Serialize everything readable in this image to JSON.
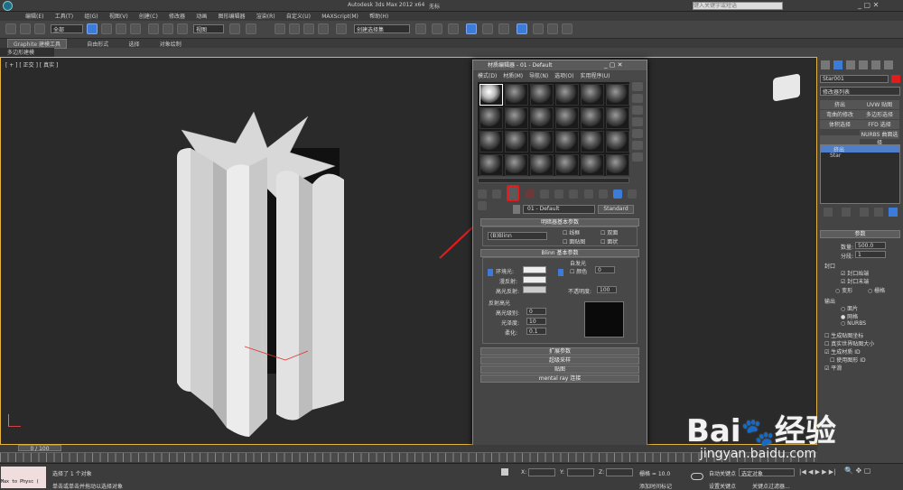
{
  "title_bar": {
    "app": "Autodesk 3ds Max  2012 x64",
    "doc": "无标",
    "search_placeholder": "键入关键字或短语"
  },
  "menu": [
    "编辑(E)",
    "工具(T)",
    "组(G)",
    "视图(V)",
    "创建(C)",
    "修改器",
    "动画",
    "图形编辑器",
    "渲染(R)",
    "自定义(U)",
    "MAXScript(M)",
    "帮助(H)"
  ],
  "toolbar": {
    "filter_value": "全部",
    "view_value": "视图",
    "selection_set": "创建选择集"
  },
  "ribbon": {
    "tabs": [
      "Graphite 建模工具",
      "自由形式",
      "选择",
      "对象绘制"
    ]
  },
  "poly_label": "多边形建模",
  "viewport": {
    "label": "[ + ] [ 正交 ] [ 真实 ]"
  },
  "material_editor": {
    "title": "材质编辑器 - 01 - Default",
    "menu": [
      "模式(D)",
      "材质(M)",
      "导航(N)",
      "选项(O)",
      "实用程序(U)"
    ],
    "material_name": "01 - Default",
    "material_type": "Standard",
    "shader_rollout": "明暗器基本参数",
    "shader_value": "(B)Blinn",
    "shader_options": [
      "线框",
      "双面",
      "面贴图",
      "面状"
    ],
    "blinn_rollout": "Blinn 基本参数",
    "ambient": "环境光:",
    "diffuse": "漫反射:",
    "specular": "高光反射:",
    "self_illum": "自发光",
    "color_label": "颜色",
    "self_illum_value": "0",
    "opacity_label": "不透明度:",
    "opacity_value": "100",
    "spec_highlights": "反射高光",
    "spec_level_label": "高光级别:",
    "spec_level_value": "0",
    "gloss_label": "光泽度:",
    "gloss_value": "10",
    "soften_label": "柔化:",
    "soften_value": "0.1",
    "rollouts": [
      "扩展参数",
      "超级采样",
      "贴图",
      "mental ray 连接"
    ]
  },
  "right_panel": {
    "object_name": "Star001",
    "modifier_list": "修改器列表",
    "buttons": [
      "挤出",
      "UVW 贴图",
      "弯曲的修改",
      "多边形选择",
      "体积选择",
      "FFD 选择",
      "",
      "NURBS 曲面选择"
    ],
    "stack": [
      "挤出",
      "Star"
    ],
    "params_title": "参数",
    "amount_label": "数量:",
    "amount_value": "500.0",
    "segments_label": "分段:",
    "segments_value": "1",
    "capping": "封口",
    "cap_start": "封口始端",
    "cap_end": "封口末端",
    "morph": "变形",
    "grid": "栅格",
    "output": "输出",
    "patch": "面片",
    "mesh": "网格",
    "nurbs": "NURBS",
    "gen_map": "生成贴图坐标",
    "real_world": "真实世界贴图大小",
    "gen_mat_ids": "生成材质 ID",
    "use_shape_ids": "使用图形 ID",
    "smooth": "平滑"
  },
  "timeline": {
    "frame": "0 / 100",
    "ticks": [
      "0",
      "5",
      "10",
      "15",
      "20",
      "25",
      "30",
      "35",
      "40",
      "45",
      "50",
      "55",
      "60",
      "65",
      "70",
      "75",
      "80",
      "85",
      "90",
      "95",
      "100"
    ]
  },
  "status": {
    "maxscript": "Max to Physc (",
    "selected": "选择了 1 个对象",
    "hint": "单击或单击并拖动以选择对象",
    "x": "X:",
    "y": "Y:",
    "z": "Z:",
    "grid": "栅格 = 10.0",
    "add_time_tag": "添加时间标记",
    "auto_key": "自动关键点",
    "selected_obj": "选定对象",
    "set_key": "设置关键点",
    "key_filters": "关键点过滤器..."
  },
  "watermark": {
    "text": "Bai",
    "text2": "经验",
    "url": "jingyan.baidu.com"
  },
  "colors": {
    "highlight": "#e31b1b",
    "viewport_border": "#e3b540"
  }
}
